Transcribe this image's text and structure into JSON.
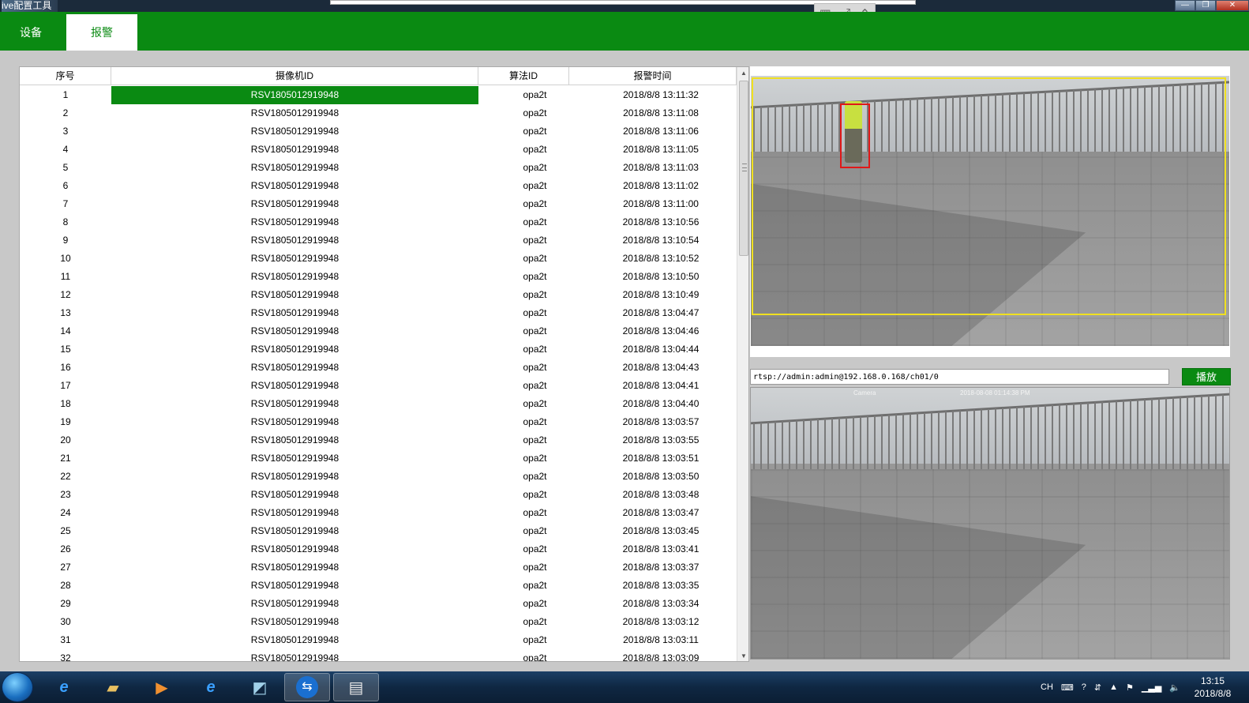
{
  "window": {
    "title": "ive配置工具",
    "controls": [
      "—",
      "❐",
      "✕"
    ]
  },
  "floating_toolbar": {
    "icons": [
      "grid-icon",
      "fullscreen-icon",
      "collapse-icon"
    ]
  },
  "tabs": [
    {
      "label": "设备",
      "active": false
    },
    {
      "label": "报警",
      "active": true
    }
  ],
  "table": {
    "headers": [
      "序号",
      "摄像机ID",
      "算法ID",
      "报警时间"
    ],
    "rows": [
      [
        "1",
        "RSV1805012919948",
        "opa2t",
        "2018/8/8 13:11:32"
      ],
      [
        "2",
        "RSV1805012919948",
        "opa2t",
        "2018/8/8 13:11:08"
      ],
      [
        "3",
        "RSV1805012919948",
        "opa2t",
        "2018/8/8 13:11:06"
      ],
      [
        "4",
        "RSV1805012919948",
        "opa2t",
        "2018/8/8 13:11:05"
      ],
      [
        "5",
        "RSV1805012919948",
        "opa2t",
        "2018/8/8 13:11:03"
      ],
      [
        "6",
        "RSV1805012919948",
        "opa2t",
        "2018/8/8 13:11:02"
      ],
      [
        "7",
        "RSV1805012919948",
        "opa2t",
        "2018/8/8 13:11:00"
      ],
      [
        "8",
        "RSV1805012919948",
        "opa2t",
        "2018/8/8 13:10:56"
      ],
      [
        "9",
        "RSV1805012919948",
        "opa2t",
        "2018/8/8 13:10:54"
      ],
      [
        "10",
        "RSV1805012919948",
        "opa2t",
        "2018/8/8 13:10:52"
      ],
      [
        "11",
        "RSV1805012919948",
        "opa2t",
        "2018/8/8 13:10:50"
      ],
      [
        "12",
        "RSV1805012919948",
        "opa2t",
        "2018/8/8 13:10:49"
      ],
      [
        "13",
        "RSV1805012919948",
        "opa2t",
        "2018/8/8 13:04:47"
      ],
      [
        "14",
        "RSV1805012919948",
        "opa2t",
        "2018/8/8 13:04:46"
      ],
      [
        "15",
        "RSV1805012919948",
        "opa2t",
        "2018/8/8 13:04:44"
      ],
      [
        "16",
        "RSV1805012919948",
        "opa2t",
        "2018/8/8 13:04:43"
      ],
      [
        "17",
        "RSV1805012919948",
        "opa2t",
        "2018/8/8 13:04:41"
      ],
      [
        "18",
        "RSV1805012919948",
        "opa2t",
        "2018/8/8 13:04:40"
      ],
      [
        "19",
        "RSV1805012919948",
        "opa2t",
        "2018/8/8 13:03:57"
      ],
      [
        "20",
        "RSV1805012919948",
        "opa2t",
        "2018/8/8 13:03:55"
      ],
      [
        "21",
        "RSV1805012919948",
        "opa2t",
        "2018/8/8 13:03:51"
      ],
      [
        "22",
        "RSV1805012919948",
        "opa2t",
        "2018/8/8 13:03:50"
      ],
      [
        "23",
        "RSV1805012919948",
        "opa2t",
        "2018/8/8 13:03:48"
      ],
      [
        "24",
        "RSV1805012919948",
        "opa2t",
        "2018/8/8 13:03:47"
      ],
      [
        "25",
        "RSV1805012919948",
        "opa2t",
        "2018/8/8 13:03:45"
      ],
      [
        "26",
        "RSV1805012919948",
        "opa2t",
        "2018/8/8 13:03:41"
      ],
      [
        "27",
        "RSV1805012919948",
        "opa2t",
        "2018/8/8 13:03:37"
      ],
      [
        "28",
        "RSV1805012919948",
        "opa2t",
        "2018/8/8 13:03:35"
      ],
      [
        "29",
        "RSV1805012919948",
        "opa2t",
        "2018/8/8 13:03:34"
      ],
      [
        "30",
        "RSV1805012919948",
        "opa2t",
        "2018/8/8 13:03:12"
      ],
      [
        "31",
        "RSV1805012919948",
        "opa2t",
        "2018/8/8 13:03:11"
      ],
      [
        "32",
        "RSV1805012919948",
        "opa2t",
        "2018/8/8 13:03:09"
      ]
    ],
    "selected_row": 0
  },
  "stream": {
    "url": "rtsp://admin:admin@192.168.0.168/ch01/0",
    "play_label": "播放",
    "overlay_camera": "Camera",
    "overlay_time": "2018-08-08 01:14:38 PM"
  },
  "taskbar": {
    "apps": [
      "ie-icon",
      "folder-icon",
      "media-player-icon",
      "ie-icon",
      "notepad-icon",
      "teamviewer-icon",
      "app-window-icon"
    ],
    "tray_lang": "CH",
    "clock_time": "13:15",
    "clock_date": "2018/8/8"
  },
  "colors": {
    "accent": "#0a8a12",
    "roi": "#f0e020",
    "detection": "#e01818"
  }
}
